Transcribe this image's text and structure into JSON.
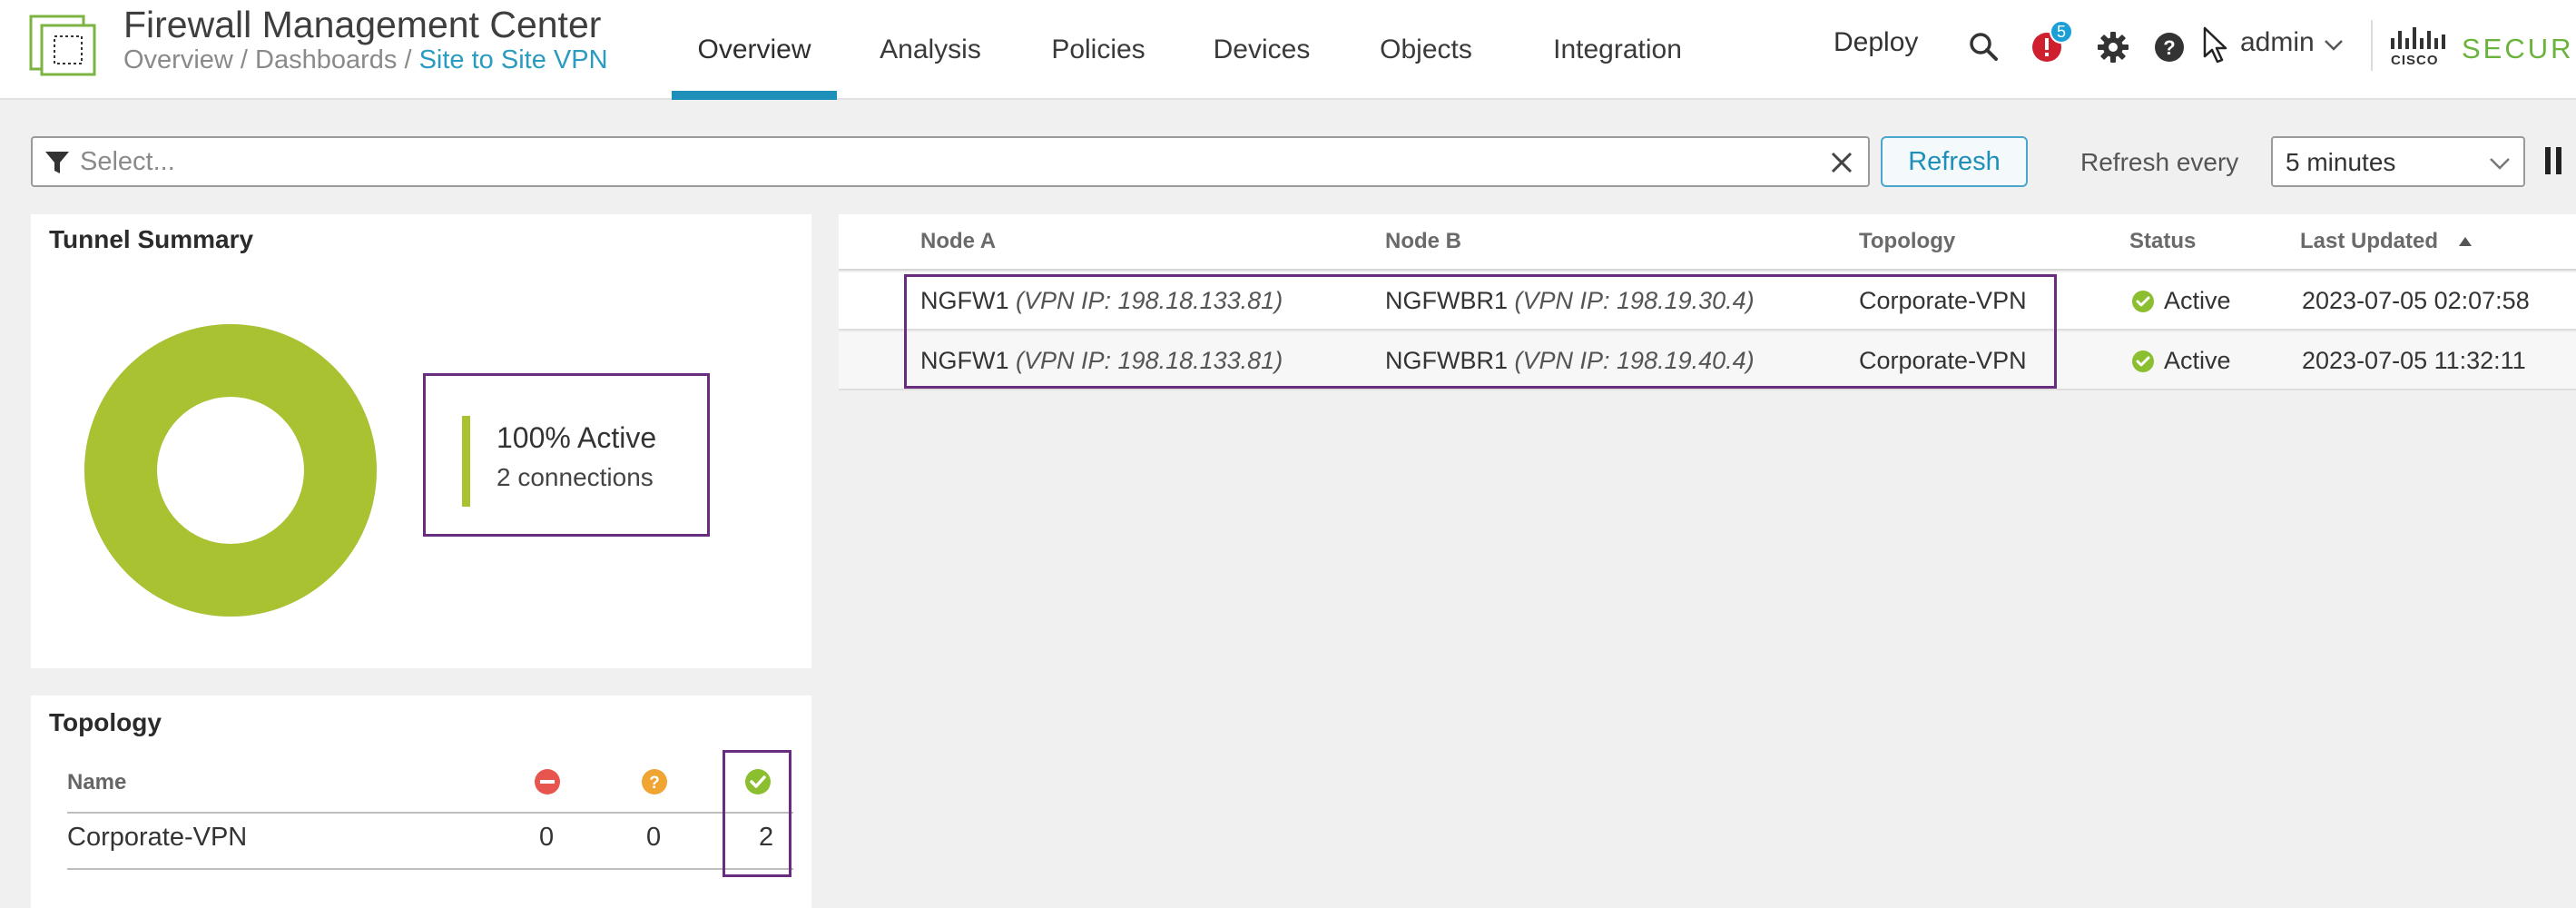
{
  "header": {
    "app_title": "Firewall Management Center",
    "breadcrumb": {
      "part1": "Overview",
      "sep1": " / ",
      "part2": "Dashboards",
      "sep2": " / ",
      "current": "Site to Site VPN"
    },
    "nav_tabs": [
      {
        "label": "Overview",
        "active": true
      },
      {
        "label": "Analysis",
        "active": false
      },
      {
        "label": "Policies",
        "active": false
      },
      {
        "label": "Devices",
        "active": false
      },
      {
        "label": "Objects",
        "active": false
      },
      {
        "label": "Integration",
        "active": false
      }
    ],
    "deploy_label": "Deploy",
    "notification_count": "5",
    "user_label": "admin",
    "brand_small": "CISCO",
    "brand_label": "SECURE"
  },
  "filter": {
    "placeholder": "Select...",
    "refresh_label": "Refresh",
    "refresh_every_label": "Refresh every",
    "interval_value": "5 minutes"
  },
  "tunnel_summary": {
    "title": "Tunnel Summary",
    "active_percent_label": "100% Active",
    "connections_label": "2 connections",
    "active_fraction": 1.0
  },
  "topology": {
    "title": "Topology",
    "header_name": "Name",
    "rows": [
      {
        "name": "Corporate-VPN",
        "down": "0",
        "unknown": "0",
        "active": "2"
      }
    ]
  },
  "tunnels_table": {
    "columns": [
      "Node A",
      "Node B",
      "Topology",
      "Status",
      "Last Updated"
    ],
    "rows": [
      {
        "node_a": "NGFW1",
        "node_a_ip": "(VPN IP: 198.18.133.81)",
        "node_b": "NGFWBR1",
        "node_b_ip": "(VPN IP: 198.19.30.4)",
        "topology": "Corporate-VPN",
        "status": "Active",
        "last_updated": "2023-07-05 02:07:58"
      },
      {
        "node_a": "NGFW1",
        "node_a_ip": "(VPN IP: 198.18.133.81)",
        "node_b": "NGFWBR1",
        "node_b_ip": "(VPN IP: 198.19.40.4)",
        "topology": "Corporate-VPN",
        "status": "Active",
        "last_updated": "2023-07-05 11:32:11"
      }
    ]
  },
  "colors": {
    "accent": "#1d8fb8",
    "active_green": "#a8c232",
    "status_green": "#8cbf2f",
    "down_red": "#e8554e",
    "unknown_orange": "#f0a431",
    "highlight_purple": "#6a2c7e",
    "notif_red": "#cf2030"
  }
}
